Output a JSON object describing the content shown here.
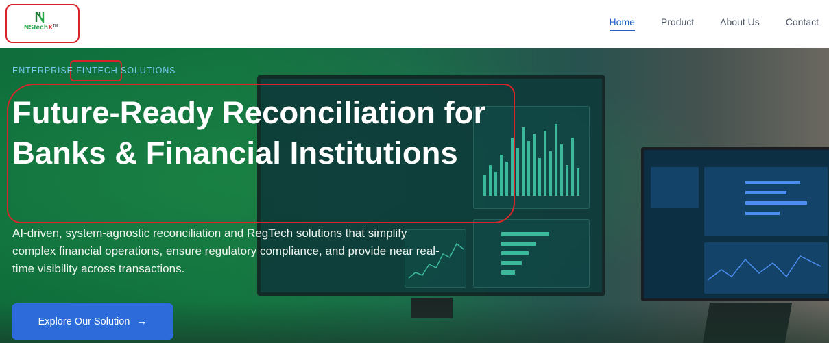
{
  "brand": {
    "name_main": "NStech",
    "name_accent": "X",
    "trademark": "TM",
    "logo_icon": "n-mark-icon"
  },
  "nav": {
    "items": [
      {
        "label": "Home",
        "active": true
      },
      {
        "label": "Product",
        "active": false
      },
      {
        "label": "About Us",
        "active": false
      },
      {
        "label": "Contact",
        "active": false
      }
    ]
  },
  "hero": {
    "eyebrow": "ENTERPRISE FINTECH SOLUTIONS",
    "title": "Future-Ready Reconciliation for Banks & Financial Institutions",
    "subtitle": "AI-driven, system-agnostic reconciliation and RegTech solutions that simplify complex financial operations, ensure regulatory compliance, and provide near real-time visibility across transactions.",
    "cta_label": "Explore Our Solution",
    "cta_icon": "arrow-right-icon"
  },
  "colors": {
    "accent": "#2c6bd9",
    "brand_green": "#2aa64a",
    "brand_red": "#d4252a",
    "annotation_red": "#d9252a",
    "nav_active": "#1f5fbf"
  }
}
